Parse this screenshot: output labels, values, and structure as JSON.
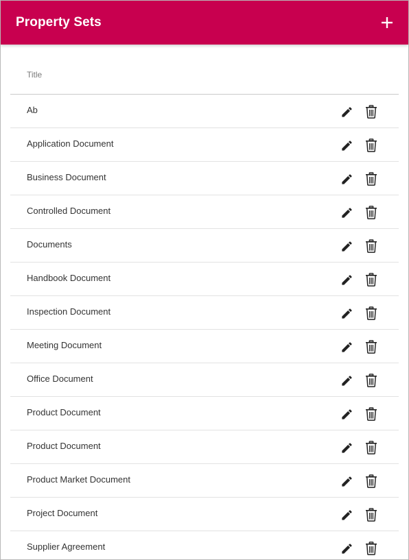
{
  "header": {
    "title": "Property Sets",
    "add_icon": "plus-icon"
  },
  "colors": {
    "header_bg": "#c8004f",
    "header_text": "#ffffff"
  },
  "table": {
    "columns": [
      "Title"
    ],
    "rows": [
      {
        "title": "Ab"
      },
      {
        "title": "Application Document"
      },
      {
        "title": "Business Document"
      },
      {
        "title": "Controlled Document"
      },
      {
        "title": "Documents"
      },
      {
        "title": "Handbook Document"
      },
      {
        "title": "Inspection Document"
      },
      {
        "title": "Meeting Document"
      },
      {
        "title": "Office Document"
      },
      {
        "title": "Product Document"
      },
      {
        "title": "Product Document"
      },
      {
        "title": "Product Market Document"
      },
      {
        "title": "Project Document"
      },
      {
        "title": "Supplier Agreement"
      }
    ],
    "row_actions": [
      "pencil-icon",
      "trash-icon"
    ]
  }
}
